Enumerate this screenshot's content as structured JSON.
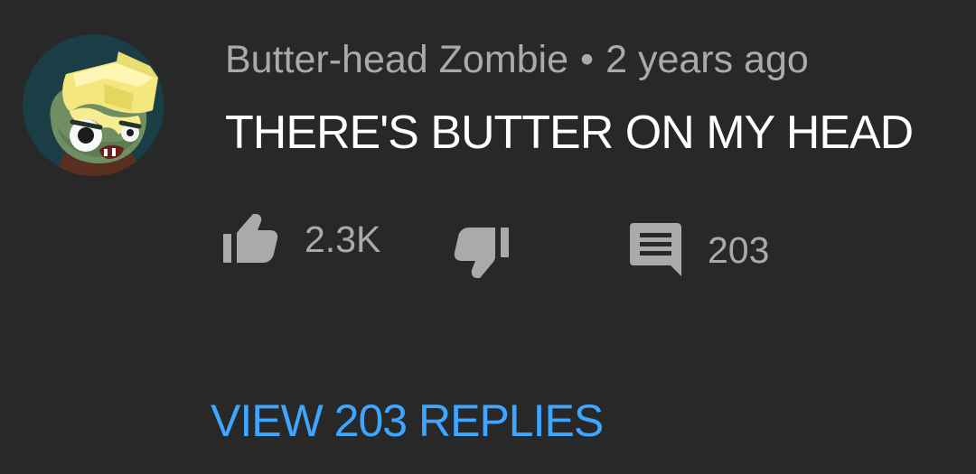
{
  "comment": {
    "author": "Butter-head Zombie",
    "separator": "•",
    "timestamp": "2 years ago",
    "text": "THERE'S BUTTER ON MY HEAD",
    "avatar_icon": "zombie-avatar-icon",
    "actions": {
      "like_icon": "thumb-up-icon",
      "like_count": "2.3K",
      "dislike_icon": "thumb-down-icon",
      "reply_icon": "comment-icon",
      "reply_count": "203"
    },
    "view_replies_label": "VIEW 203 REPLIES"
  },
  "colors": {
    "background": "#282828",
    "meta_text": "#aaaaaa",
    "primary_text": "#ffffff",
    "link_blue": "#3ea6ff",
    "icon_gray": "#aaaaaa"
  }
}
